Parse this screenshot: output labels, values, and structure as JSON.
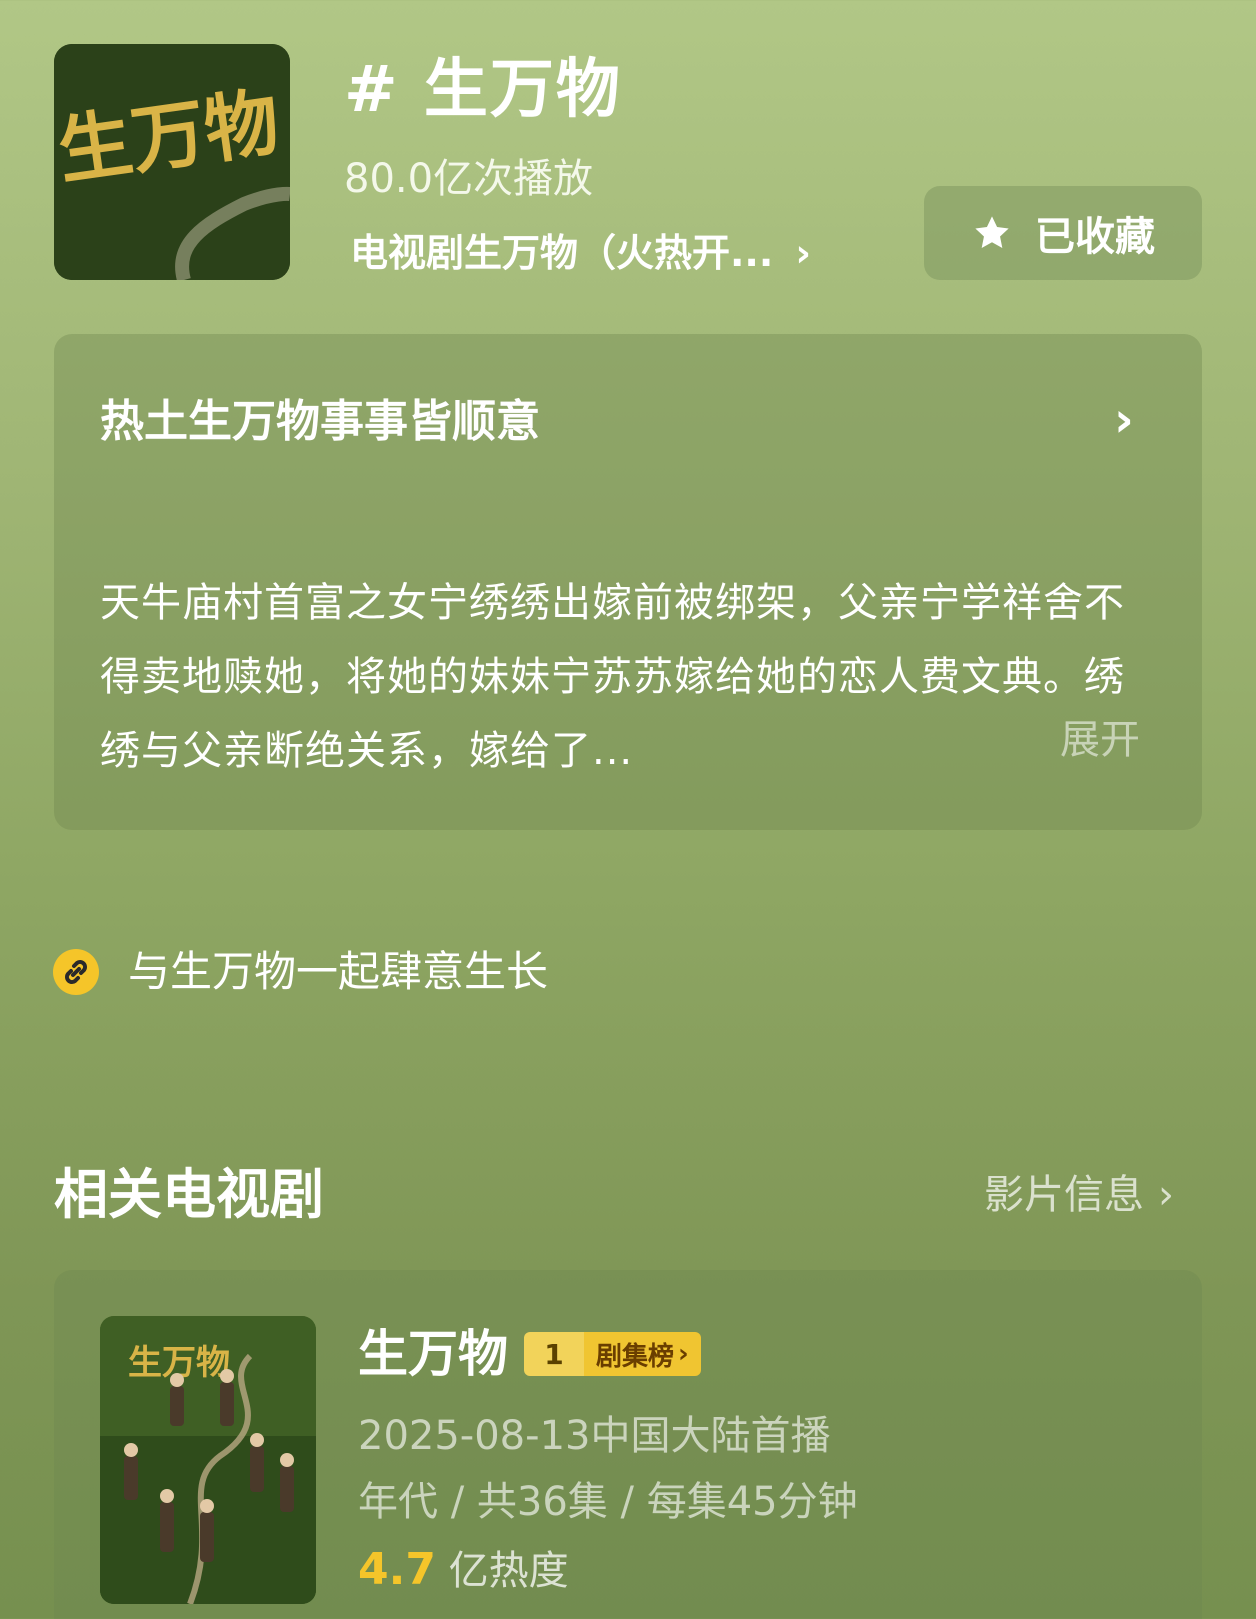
{
  "header": {
    "cover_logo_text": "生万物",
    "topic_title": "# 生万物",
    "play_count": "80.0亿次播放",
    "related_link_label": "电视剧生万物（火热开...",
    "collect_button_label": "已收藏",
    "colors": {
      "accent_star": "#ffffff"
    }
  },
  "intro": {
    "title": "热土生万物事事皆顺意",
    "description": "天牛庙村首富之女宁绣绣出嫁前被绑架，父亲宁学祥舍不得卖地赎她，将她的妹妹宁苏苏嫁给她的恋人费文典。绣绣与父亲断绝关系，嫁给了...",
    "expand_label": "展开"
  },
  "slogan": {
    "icon": "link-icon",
    "text": "与生万物一起肆意生长"
  },
  "related_tv": {
    "section_title": "相关电视剧",
    "info_link_label": "影片信息",
    "item": {
      "name": "生万物",
      "rank_number": "1",
      "rank_label": "剧集榜",
      "premiere": "2025-08-13中国大陆首播",
      "meta": "年代 / 共36集 / 每集45分钟",
      "heat_value": "4.7",
      "heat_unit": "亿热度",
      "colors": {
        "heat": "#f5c52a",
        "badge": "#f0c531"
      }
    }
  }
}
